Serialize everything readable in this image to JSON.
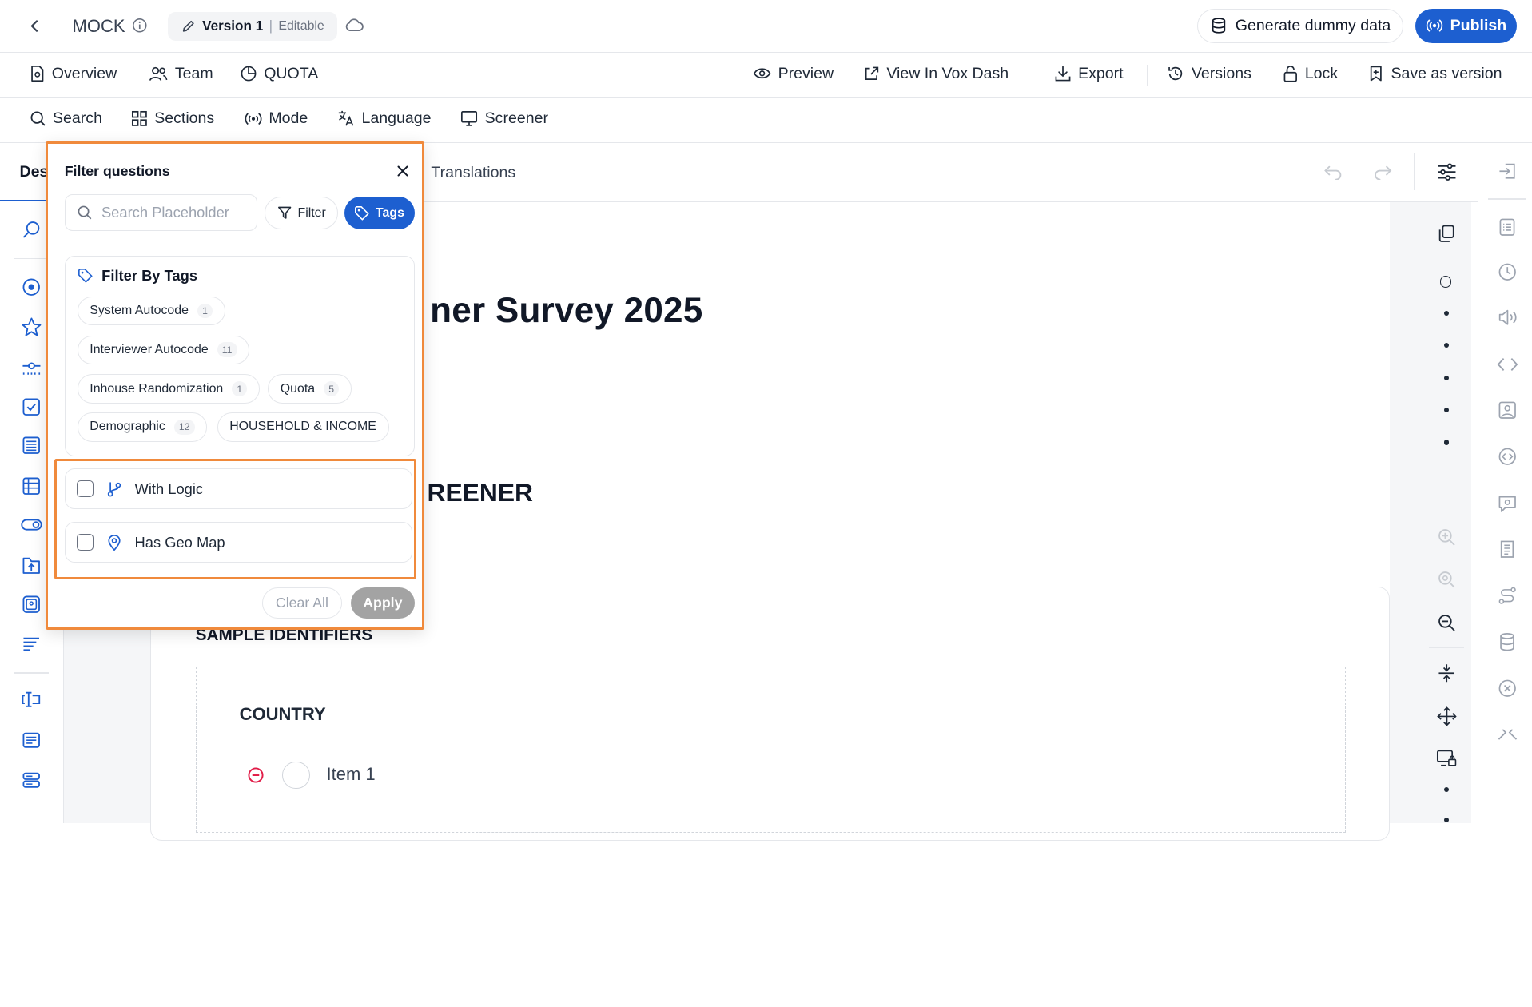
{
  "header": {
    "title": "MOCK",
    "version_name": "Version 1",
    "version_separator": "|",
    "version_state": "Editable",
    "generate_label": "Generate dummy data",
    "publish_label": "Publish"
  },
  "nav": {
    "overview": "Overview",
    "team": "Team",
    "quota": "QUOTA",
    "preview": "Preview",
    "view_vox": "View In Vox Dash",
    "export": "Export",
    "versions": "Versions",
    "lock": "Lock",
    "save_version": "Save as version"
  },
  "toolbar": {
    "search": "Search",
    "sections": "Sections",
    "mode": "Mode",
    "language": "Language",
    "screener": "Screener"
  },
  "tabs": {
    "design": "Des",
    "translations": "Translations"
  },
  "survey": {
    "title": "ner Survey 2025",
    "section": "REENER",
    "sample_identifiers": "SAMPLE IDENTIFIERS",
    "question": "COUNTRY",
    "item1": "Item 1"
  },
  "filter_popover": {
    "title": "Filter questions",
    "search_placeholder": "Search Placeholder",
    "filter_label": "Filter",
    "tags_label": "Tags",
    "tags_heading": "Filter By Tags",
    "tags": [
      {
        "label": "System Autocode",
        "count": "1"
      },
      {
        "label": "Interviewer Autocode",
        "count": "11"
      },
      {
        "label": "Inhouse Randomization",
        "count": "1"
      },
      {
        "label": "Quota",
        "count": "5"
      },
      {
        "label": "Demographic",
        "count": "12"
      },
      {
        "label": "HOUSEHOLD & INCOME",
        "count": ""
      }
    ],
    "options": [
      {
        "label": "With Logic",
        "checked": false
      },
      {
        "label": "Has Geo Map",
        "checked": false
      }
    ],
    "clear_label": "Clear All",
    "apply_label": "Apply"
  },
  "colors": {
    "primary": "#1d5fd0",
    "highlight": "#f08a3c",
    "danger": "#e11d48",
    "disabled": "#a3a3a3"
  }
}
